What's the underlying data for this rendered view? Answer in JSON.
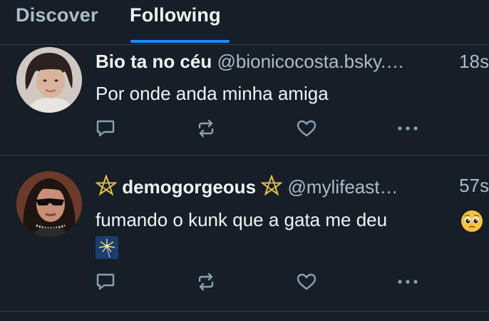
{
  "colors": {
    "background": "#161e27",
    "accent": "#208bfe",
    "divider": "#2e4052",
    "text_primary": "#f1f3f5",
    "text_secondary": "#aebbc9",
    "icon": "#8d9fb3"
  },
  "tabs": [
    {
      "label": "Discover",
      "active": false
    },
    {
      "label": "Following",
      "active": true
    }
  ],
  "posts": [
    {
      "display_name": "Bio ta no céu",
      "handle": "@bionicocosta.bsky.…",
      "time": "18s",
      "text": "Por onde anda minha amiga",
      "icons": [
        "reply-icon",
        "repost-icon",
        "like-icon",
        "more-icon"
      ]
    },
    {
      "display_name": "demogorgeous",
      "handle": "@mylifeast…",
      "time": "57s",
      "text": "fumando o kunk que a gata me deu",
      "icons": [
        "pentagram-icon",
        "pleading-face-emoji",
        "sparkler-emoji",
        "reply-icon",
        "repost-icon",
        "like-icon",
        "more-icon"
      ]
    }
  ]
}
